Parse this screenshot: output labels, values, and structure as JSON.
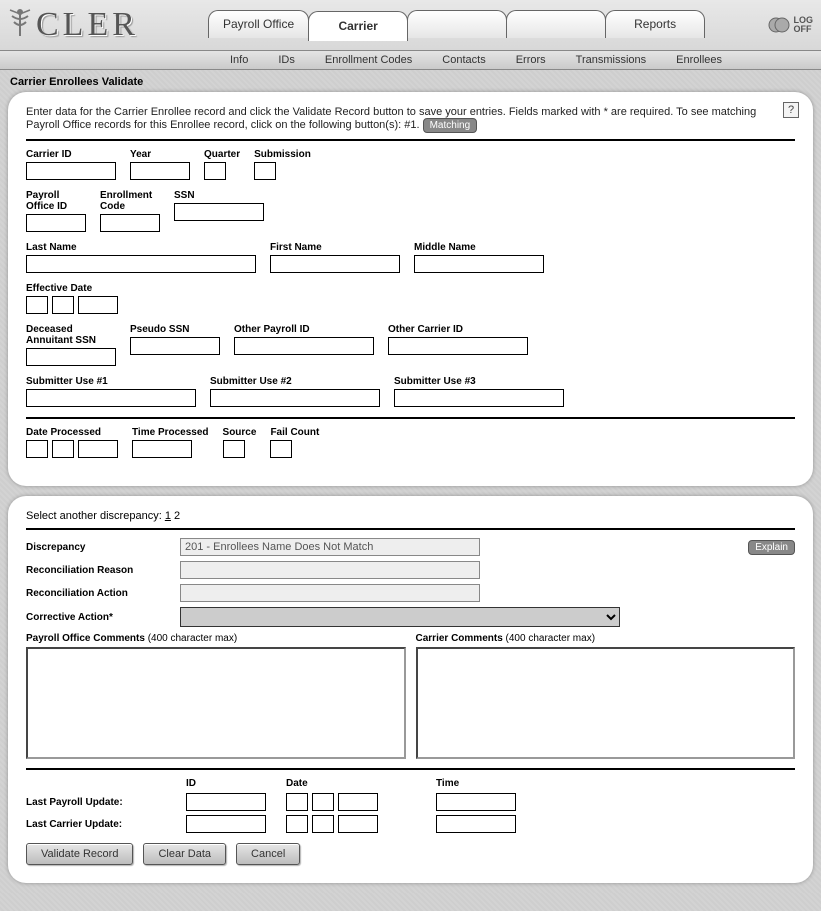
{
  "app": {
    "logo_text": "CLER"
  },
  "header_tabs": {
    "payroll_office": "Payroll Office",
    "carrier": "Carrier",
    "blank1": "",
    "blank2": "",
    "reports": "Reports"
  },
  "logoff": {
    "line1": "LOG",
    "line2": "OFF"
  },
  "subnav": {
    "info": "Info",
    "ids": "IDs",
    "enrollment_codes": "Enrollment Codes",
    "contacts": "Contacts",
    "errors": "Errors",
    "transmissions": "Transmissions",
    "enrollees": "Enrollees"
  },
  "page_title": "Carrier Enrollees Validate",
  "instructions": {
    "part1": "Enter data for the Carrier Enrollee record and click the Validate Record button to save your entries.  Fields marked with * are required.   To see matching Payroll Office records for this Enrollee record, click on the following button(s): #1. ",
    "matching_btn": "Matching"
  },
  "labels": {
    "carrier_id": "Carrier ID",
    "year": "Year",
    "quarter": "Quarter",
    "submission": "Submission",
    "payroll_office_id": "Payroll\nOffice ID",
    "enrollment_code": "Enrollment\nCode",
    "ssn": "SSN",
    "last_name": "Last Name",
    "first_name": "First Name",
    "middle_name": "Middle Name",
    "effective_date": "Effective Date",
    "deceased_annuitant_ssn": "Deceased\nAnnuitant SSN",
    "pseudo_ssn": "Pseudo SSN",
    "other_payroll_id": "Other Payroll ID",
    "other_carrier_id": "Other Carrier ID",
    "submitter1": "Submitter Use #1",
    "submitter2": "Submitter Use #2",
    "submitter3": "Submitter Use #3",
    "date_processed": "Date Processed",
    "time_processed": "Time Processed",
    "source": "Source",
    "fail_count": "Fail Count"
  },
  "discrepancy_section": {
    "select_text_prefix": "Select another discrepancy: ",
    "link1": "1",
    "sep": " ",
    "link2": "2",
    "discrepancy_label": "Discrepancy",
    "discrepancy_value": "201 - Enrollees Name Does Not Match",
    "explain_btn": "Explain",
    "recon_reason_label": "Reconciliation Reason",
    "recon_reason_value": "",
    "recon_action_label": "Reconciliation Action",
    "recon_action_value": "",
    "corrective_action_label": "Corrective Action*",
    "po_comments_label_bold": "Payroll Office Comments",
    "po_comments_label_rest": " (400 character max)",
    "carrier_comments_label_bold": "Carrier Comments",
    "carrier_comments_label_rest": " (400 character max)"
  },
  "updates": {
    "id_hdr": "ID",
    "date_hdr": "Date",
    "time_hdr": "Time",
    "last_payroll_label": "Last Payroll Update:",
    "last_carrier_label": "Last Carrier Update:"
  },
  "buttons": {
    "validate": "Validate Record",
    "clear": "Clear Data",
    "cancel": "Cancel"
  }
}
